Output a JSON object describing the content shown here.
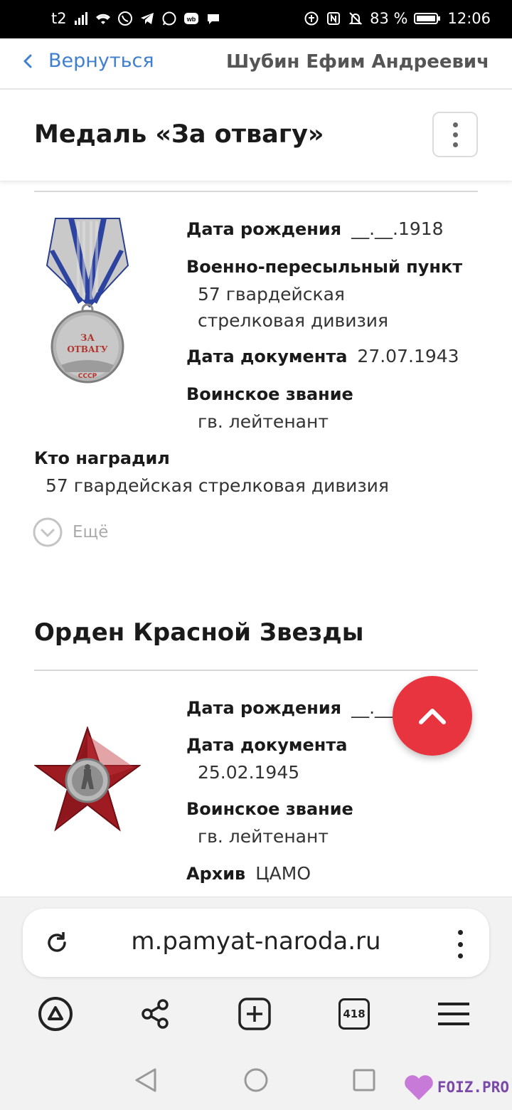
{
  "status_bar": {
    "carrier": "t2",
    "battery_percent": "83 %",
    "time": "12:06"
  },
  "header": {
    "back_label": "Вернуться",
    "person_name": "Шубин Ефим Андреевич"
  },
  "award_1": {
    "title": "Медаль «За отвагу»",
    "fields": {
      "birth_label": "Дата рождения",
      "birth_value": "__.__.1918",
      "point_label": "Военно-пересыльный пункт",
      "point_value": "57 гвардейская стрелковая дивизия",
      "doc_date_label": "Дата документа",
      "doc_date_value": "27.07.1943",
      "rank_label": "Воинское звание",
      "rank_value": "гв. лейтенант",
      "awarder_label": "Кто наградил",
      "awarder_value": "57 гвардейская стрелковая дивизия"
    },
    "medal_text_top": "ЗА",
    "medal_text_bottom": "ОТВАГУ",
    "medal_text_ussr": "СССР",
    "more_label": "Ещё"
  },
  "award_2": {
    "title": "Орден Красной Звезды",
    "fields": {
      "birth_label": "Дата рождения",
      "birth_value": "__.__.19",
      "doc_date_label": "Дата документа",
      "doc_date_value": "25.02.1945",
      "rank_label": "Воинское звание",
      "rank_value": "гв. лейтенант",
      "archive_label": "Архив",
      "archive_value": "ЦАМО"
    }
  },
  "browser": {
    "url": "m.pamyat-naroda.ru",
    "tab_count": "418"
  },
  "watermark": "FOIZ.PRO",
  "colors": {
    "accent_blue": "#3f7fd0",
    "fab_red": "#e8343f",
    "star_red": "#9e1b22"
  }
}
